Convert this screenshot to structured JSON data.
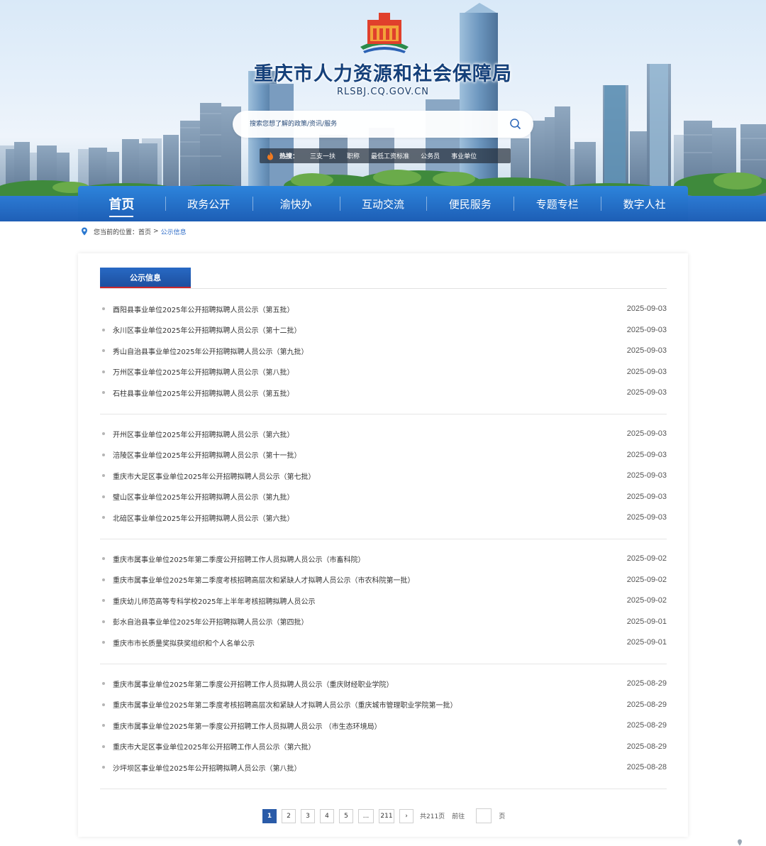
{
  "header": {
    "site_title": "重庆市人力资源和社会保障局",
    "site_domain": "RLSBJ.CQ.GOV.CN",
    "logo_icon": "emblem-logo-icon",
    "search": {
      "placeholder": "搜索您想了解的政策/资讯/服务",
      "icon": "search-icon"
    },
    "hot": {
      "label": "热搜：",
      "icon": "flame-icon",
      "items": [
        "三支一扶",
        "职称",
        "最低工资标准",
        "公务员",
        "事业单位"
      ]
    }
  },
  "nav": {
    "items": [
      {
        "label": "首页",
        "active": true
      },
      {
        "label": "政务公开"
      },
      {
        "label": "渝快办"
      },
      {
        "label": "互动交流"
      },
      {
        "label": "便民服务"
      },
      {
        "label": "专题专栏"
      },
      {
        "label": "数字人社"
      }
    ],
    "accent": "#1f5fb6"
  },
  "breadcrumb": {
    "prefix": "您当前的位置：",
    "home": "首页",
    "separator": ">",
    "current": "公示信息"
  },
  "section": {
    "tab_label": "公示信息"
  },
  "groups": [
    [
      {
        "title": "酉阳县事业单位2025年公开招聘拟聘人员公示（第五批）",
        "date": "2025-09-03"
      },
      {
        "title": "永川区事业单位2025年公开招聘拟聘人员公示（第十二批）",
        "date": "2025-09-03"
      },
      {
        "title": "秀山自治县事业单位2025年公开招聘拟聘人员公示（第九批）",
        "date": "2025-09-03"
      },
      {
        "title": "万州区事业单位2025年公开招聘拟聘人员公示（第八批）",
        "date": "2025-09-03"
      },
      {
        "title": "石柱县事业单位2025年公开招聘拟聘人员公示（第五批）",
        "date": "2025-09-03"
      }
    ],
    [
      {
        "title": "开州区事业单位2025年公开招聘拟聘人员公示（第六批）",
        "date": "2025-09-03"
      },
      {
        "title": "涪陵区事业单位2025年公开招聘拟聘人员公示（第十一批）",
        "date": "2025-09-03"
      },
      {
        "title": "重庆市大足区事业单位2025年公开招聘拟聘人员公示（第七批）",
        "date": "2025-09-03"
      },
      {
        "title": "璧山区事业单位2025年公开招聘拟聘人员公示（第九批）",
        "date": "2025-09-03"
      },
      {
        "title": "北碚区事业单位2025年公开招聘拟聘人员公示（第六批）",
        "date": "2025-09-03"
      }
    ],
    [
      {
        "title": "重庆市属事业单位2025年第二季度公开招聘工作人员拟聘人员公示（市畜科院）",
        "date": "2025-09-02"
      },
      {
        "title": "重庆市属事业单位2025年第二季度考核招聘高层次和紧缺人才拟聘人员公示（市农科院第一批）",
        "date": "2025-09-02"
      },
      {
        "title": "重庆幼儿师范高等专科学校2025年上半年考核招聘拟聘人员公示",
        "date": "2025-09-02"
      },
      {
        "title": "彭水自治县事业单位2025年公开招聘拟聘人员公示（第四批）",
        "date": "2025-09-01"
      },
      {
        "title": "重庆市市长质量奖拟获奖组织和个人名单公示",
        "date": "2025-09-01"
      }
    ],
    [
      {
        "title": "重庆市属事业单位2025年第二季度公开招聘工作人员拟聘人员公示（重庆财经职业学院）",
        "date": "2025-08-29"
      },
      {
        "title": "重庆市属事业单位2025年第二季度考核招聘高层次和紧缺人才拟聘人员公示（重庆城市管理职业学院第一批）",
        "date": "2025-08-29"
      },
      {
        "title": "重庆市属事业单位2025年第一季度公开招聘工作人员拟聘人员公示 （市生态环境局）",
        "date": "2025-08-29"
      },
      {
        "title": "重庆市大足区事业单位2025年公开招聘工作人员公示（第六批）",
        "date": "2025-08-29"
      },
      {
        "title": "沙坪坝区事业单位2025年公开招聘拟聘人员公示（第八批）",
        "date": "2025-08-28"
      }
    ]
  ],
  "pagination": {
    "pages": [
      "1",
      "2",
      "3",
      "4",
      "5"
    ],
    "current": "1",
    "ellipsis": "...",
    "last": "211",
    "next": "›",
    "total_text": "共211页",
    "goto_label": "前往",
    "page_suffix": "页"
  }
}
